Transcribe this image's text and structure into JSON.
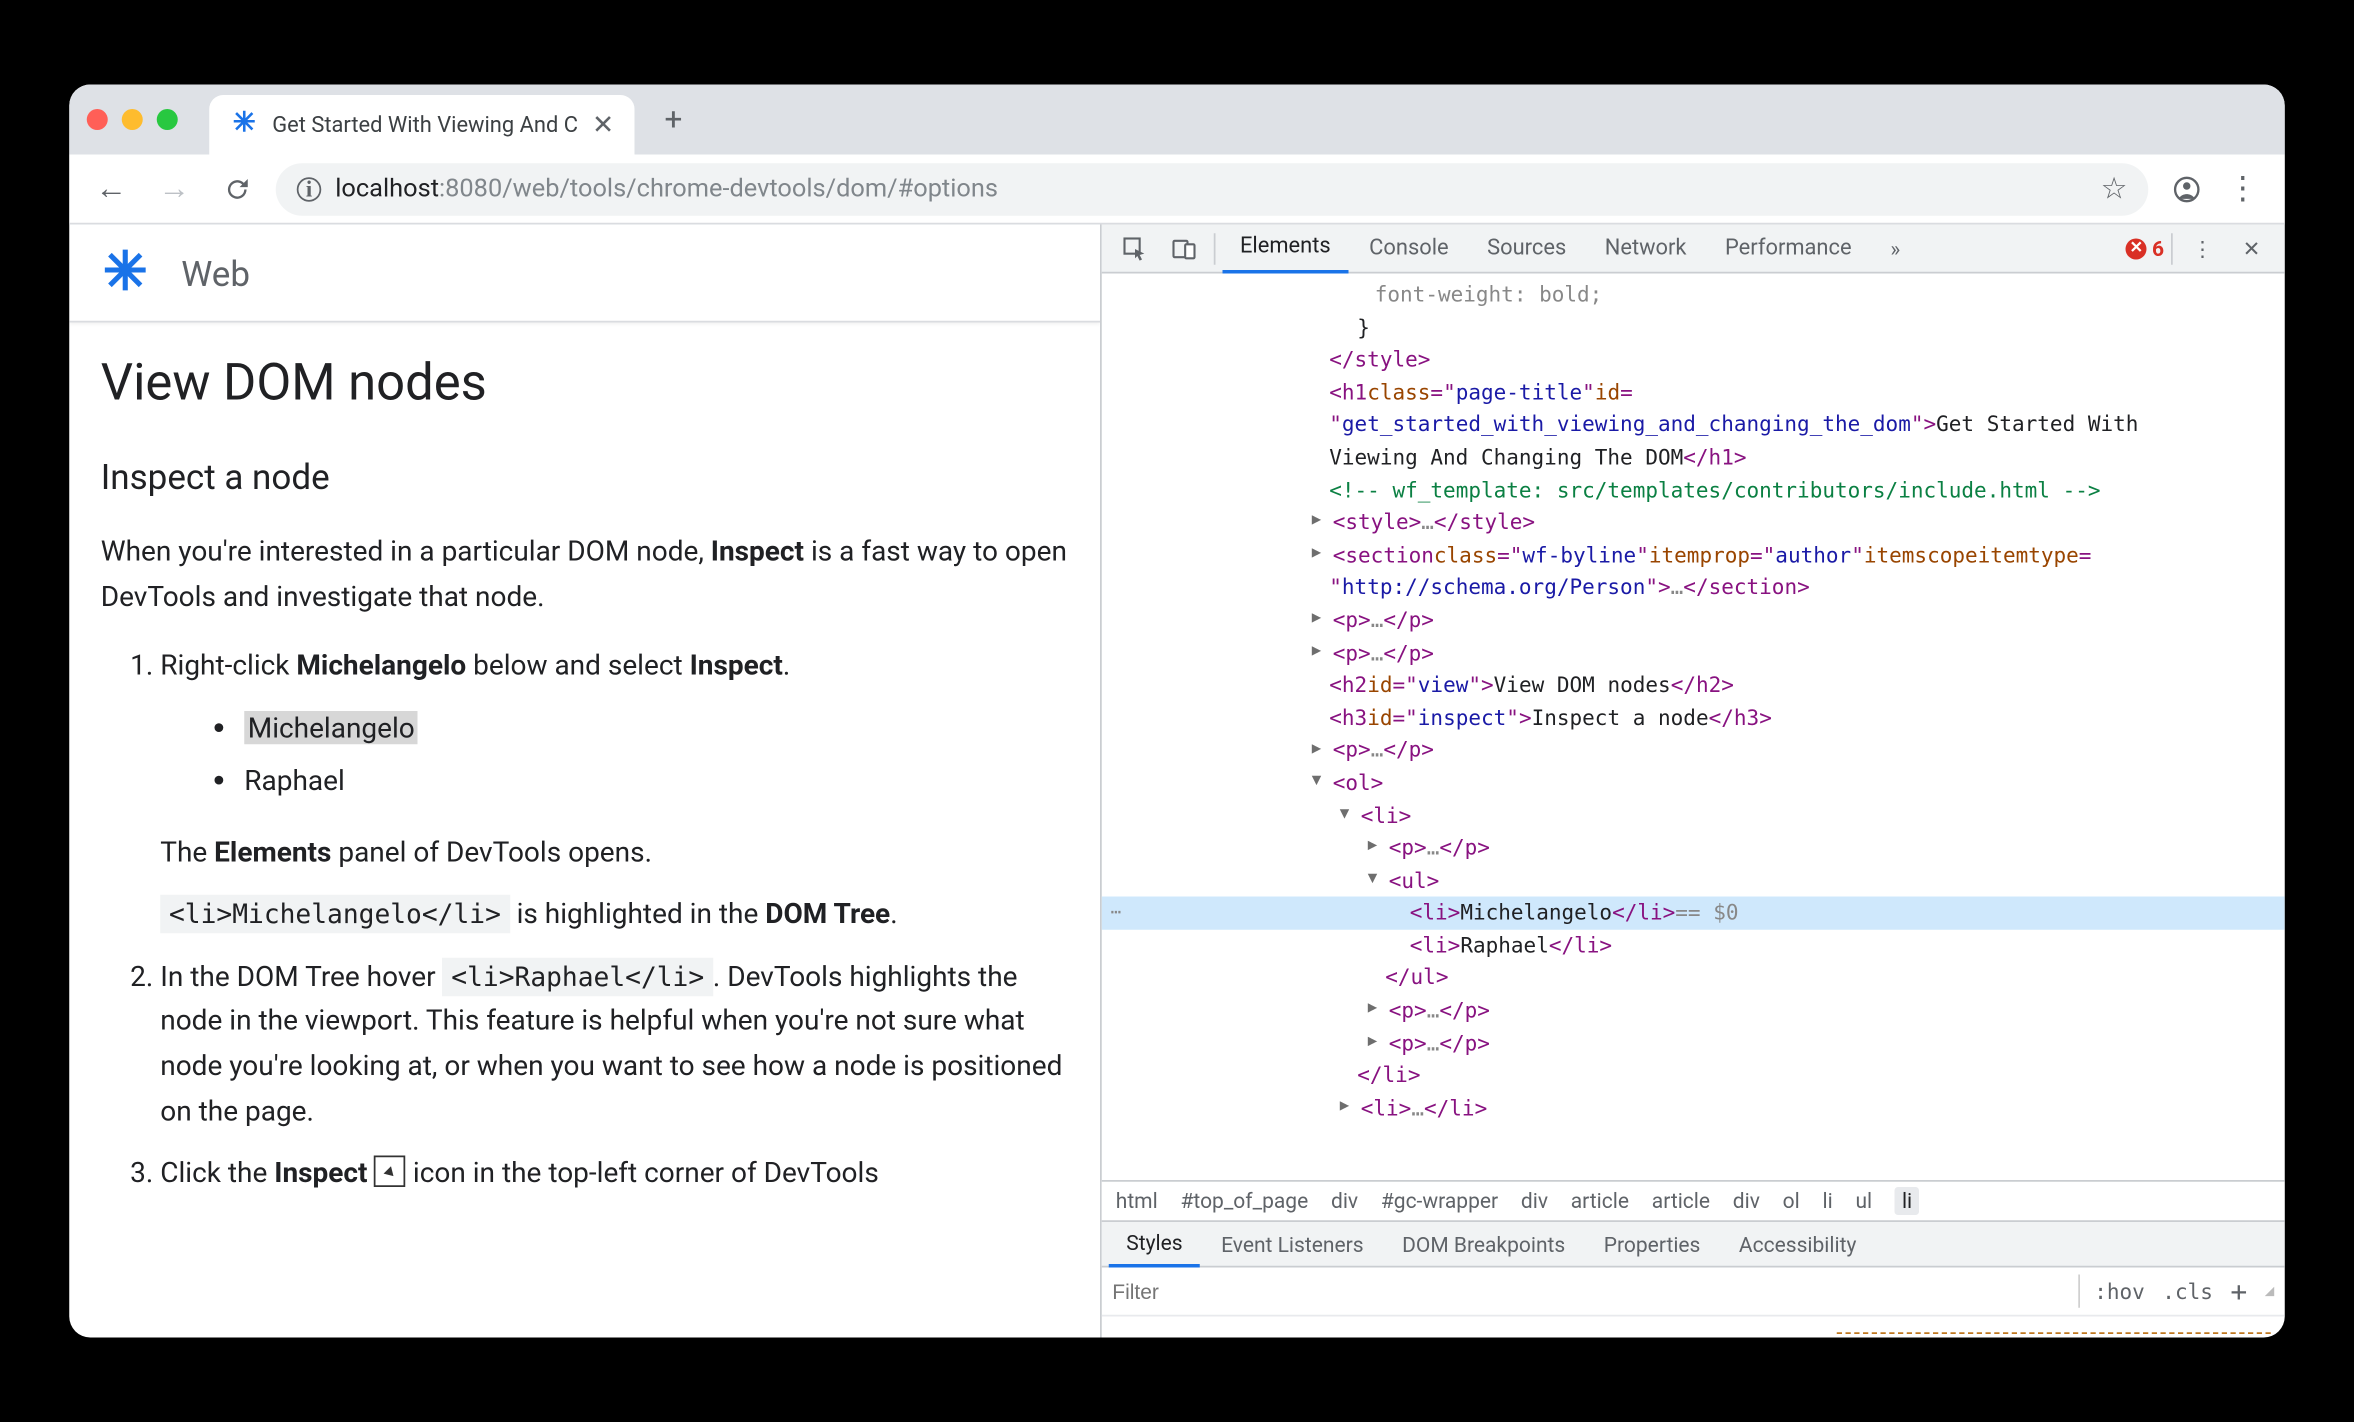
{
  "tab": {
    "title": "Get Started With Viewing And C"
  },
  "url": {
    "host": "localhost",
    "port": ":8080",
    "path": "/web/tools/chrome-devtools/dom/#options"
  },
  "site": {
    "name": "Web"
  },
  "article": {
    "h1": "View DOM nodes",
    "h2": "Inspect a node",
    "intro_a": "When you're interested in a particular DOM node, ",
    "intro_bold": "Inspect",
    "intro_b": " is a fast way to open DevTools and investigate that node.",
    "step1_a": "Right-click ",
    "step1_bold": "Michelangelo",
    "step1_b": " below and select ",
    "step1_bold2": "Inspect",
    "step1_c": ".",
    "bullet1": "Michelangelo",
    "bullet2": "Raphael",
    "step1_res_a": "The ",
    "step1_res_bold": "Elements",
    "step1_res_b": " panel of DevTools opens.",
    "step1_res2_code": "<li>Michelangelo</li>",
    "step1_res2_a": " is highlighted in the ",
    "step1_res2_bold": "DOM Tree",
    "step1_res2_b": ".",
    "step2_a": "In the DOM Tree hover ",
    "step2_code": "<li>Raphael</li>",
    "step2_b": ". DevTools highlights the node in the viewport. This feature is helpful when you're not sure what node you're looking at, or when you want to see how a node is positioned on the page.",
    "step3_a": "Click the ",
    "step3_bold": "Inspect",
    "step3_b": " icon in the top-left corner of DevTools"
  },
  "devtools": {
    "tabs": [
      "Elements",
      "Console",
      "Sources",
      "Network",
      "Performance"
    ],
    "active_tab": "Elements",
    "error_count": "6",
    "subtabs": [
      "Styles",
      "Event Listeners",
      "DOM Breakpoints",
      "Properties",
      "Accessibility"
    ],
    "active_subtab": "Styles",
    "filter_placeholder": "Filter",
    "hov": ":hov",
    "cls": ".cls",
    "crumbs": [
      "html",
      "#top_of_page",
      "div",
      "#gc-wrapper",
      "div",
      "article",
      "article",
      "div",
      "ol",
      "li",
      "ul",
      "li"
    ]
  },
  "dom": {
    "l0": "font-weight: bold;",
    "l1": "}",
    "h1_class": "page-title",
    "h1_id": "get_started_with_viewing_and_changing_the_dom",
    "h1_text": "Get Started With Viewing And Changing The DOM",
    "comment": " wf_template: src/templates/contributors/include.html ",
    "sect_class": "wf-byline",
    "sect_ip": "author",
    "sect_it": "http://schema.org/Person",
    "h2_id": "view",
    "h2_text": "View DOM nodes",
    "h3_id": "inspect",
    "h3_text": "Inspect a node",
    "li1": "Michelangelo",
    "li2": "Raphael",
    "sel_suffix": " == $0"
  }
}
